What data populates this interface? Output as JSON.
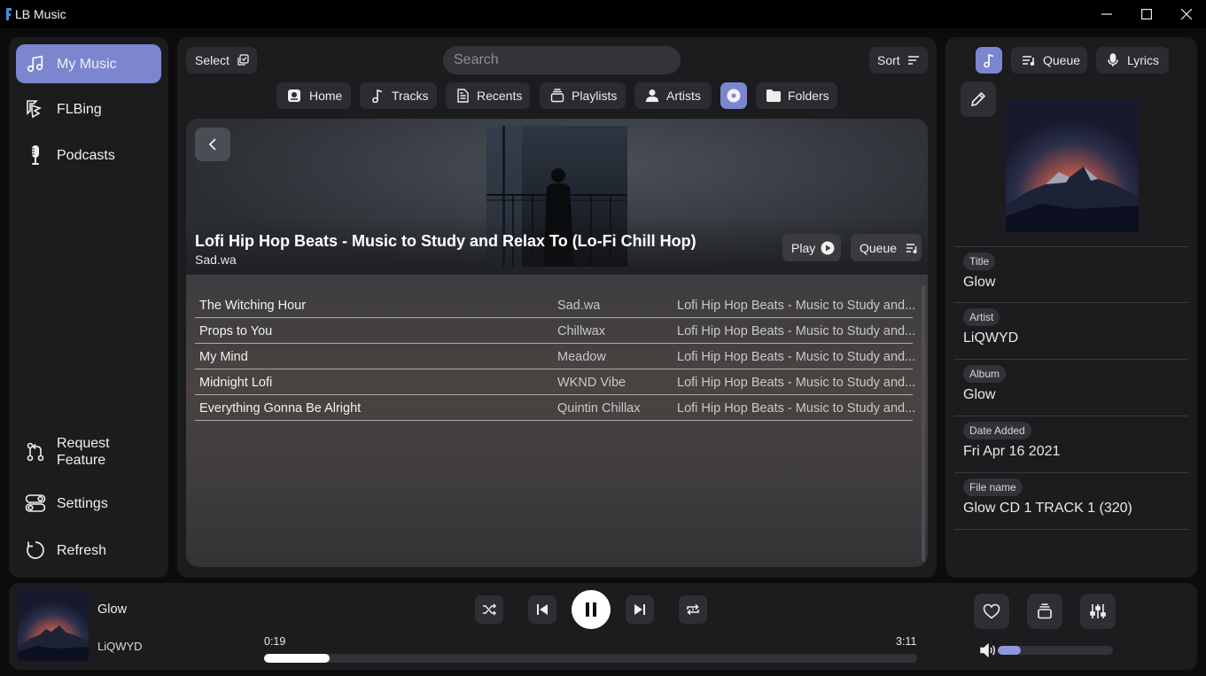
{
  "app": {
    "title": "LB Music"
  },
  "sidebar": {
    "items": [
      {
        "label": "My Music",
        "icon": "music-note-icon",
        "active": true
      },
      {
        "label": "FLBing",
        "icon": "flbing-icon"
      },
      {
        "label": "Podcasts",
        "icon": "microphone-icon"
      }
    ],
    "bottom_items": [
      {
        "label": "Request Feature",
        "icon": "git-pull-request-icon"
      },
      {
        "label": "Settings",
        "icon": "toggles-icon"
      },
      {
        "label": "Refresh",
        "icon": "refresh-icon"
      }
    ]
  },
  "toolbar": {
    "select_label": "Select",
    "search_placeholder": "Search",
    "sort_label": "Sort"
  },
  "nav_tabs": [
    {
      "label": "Home",
      "icon": "home-icon"
    },
    {
      "label": "Tracks",
      "icon": "music-note-icon"
    },
    {
      "label": "Recents",
      "icon": "document-icon"
    },
    {
      "label": "Playlists",
      "icon": "stack-icon"
    },
    {
      "label": "Artists",
      "icon": "person-icon"
    },
    {
      "label": "",
      "icon": "album-disc-icon",
      "active": true
    },
    {
      "label": "Folders",
      "icon": "folder-icon"
    }
  ],
  "album": {
    "title": "Lofi Hip Hop Beats - Music to Study and Relax To (Lo-Fi Chill Hop)",
    "artist": "Sad.wa",
    "play_label": "Play",
    "queue_label": "Queue",
    "tracks": [
      {
        "title": "The Witching Hour",
        "artist": "Sad.wa",
        "album": "Lofi Hip Hop Beats - Music to Study and..."
      },
      {
        "title": "Props to You",
        "artist": "Chillwax",
        "album": "Lofi Hip Hop Beats - Music to Study and..."
      },
      {
        "title": "My Mind",
        "artist": "Meadow",
        "album": "Lofi Hip Hop Beats - Music to Study and..."
      },
      {
        "title": "Midnight Lofi",
        "artist": "WKND Vibe",
        "album": "Lofi Hip Hop Beats - Music to Study and..."
      },
      {
        "title": "Everything Gonna Be Alright",
        "artist": "Quintin Chillax",
        "album": "Lofi Hip Hop Beats - Music to Study and..."
      }
    ]
  },
  "right_panel": {
    "tabs": {
      "queue_label": "Queue",
      "lyrics_label": "Lyrics"
    },
    "fields": [
      {
        "label": "Title",
        "value": "Glow"
      },
      {
        "label": "Artist",
        "value": "LiQWYD"
      },
      {
        "label": "Album",
        "value": "Glow"
      },
      {
        "label": "Date Added",
        "value": "Fri Apr 16 2021"
      },
      {
        "label": "File name",
        "value": "Glow CD 1 TRACK 1 (320)"
      }
    ]
  },
  "player": {
    "title": "Glow",
    "artist": "LiQWYD",
    "elapsed": "0:19",
    "duration": "3:11",
    "progress_fraction": 0.1,
    "volume_fraction": 0.2
  },
  "colors": {
    "accent": "#7c86cf",
    "panel": "#1c1c1f",
    "background": "#0c0c0d"
  }
}
